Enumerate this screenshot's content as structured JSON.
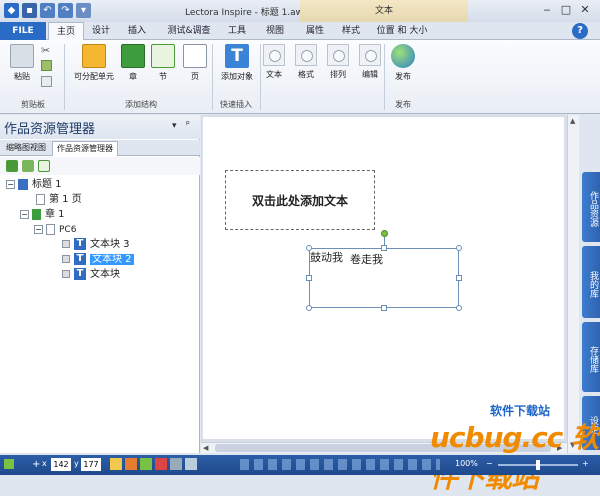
{
  "titlebar": {
    "title": "Lectora Inspire - 标题 1.awt",
    "context_tab_label": "文本",
    "help_label": "?"
  },
  "tabs": [
    {
      "label": "FILE"
    },
    {
      "label": "主页"
    },
    {
      "label": "设计"
    },
    {
      "label": "插入"
    },
    {
      "label": "测试&调查"
    },
    {
      "label": "工具"
    },
    {
      "label": "视图"
    },
    {
      "label": "属性"
    },
    {
      "label": "样式"
    },
    {
      "label": "位置 和 大小"
    }
  ],
  "ribbon": {
    "paste": "粘贴",
    "alloc_unit": "可分配单元",
    "chapter": "章",
    "section": "节",
    "page": "页",
    "add_object": "添加对象",
    "text": "文本",
    "format": "格式",
    "arrange": "排列",
    "edit": "编辑",
    "publish": "发布",
    "groups": {
      "clipboard": "剪贴板",
      "add_structure": "添加结构",
      "quick_insert": "快速插入",
      "publish": "发布"
    }
  },
  "panel": {
    "title": "作品资源管理器",
    "tab_thumbnails": "缩略图视图",
    "tab_explorer": "作品资源管理器",
    "tree": [
      {
        "label": "标题 1"
      },
      {
        "label": "第 1 页"
      },
      {
        "label": "章 1"
      },
      {
        "label": "PC6"
      },
      {
        "label": "文本块 3"
      },
      {
        "label": "文本块 2"
      },
      {
        "label": "文本块"
      }
    ]
  },
  "canvas": {
    "textbox_placeholder": "双击此处添加文本",
    "selected_text_a": "鼓动我",
    "selected_text_b": "卷走我"
  },
  "side_tabs": [
    "作品资源",
    "我的库",
    "存储库",
    "设定"
  ],
  "status": {
    "x_label": "x",
    "x_value": "142",
    "y_label": "y",
    "y_value": "177",
    "zoom": "100%"
  },
  "watermark": "ucbug.cc 软件下载站",
  "colors": {
    "accent": "#2a6cc5",
    "selection": "#3399ff"
  }
}
